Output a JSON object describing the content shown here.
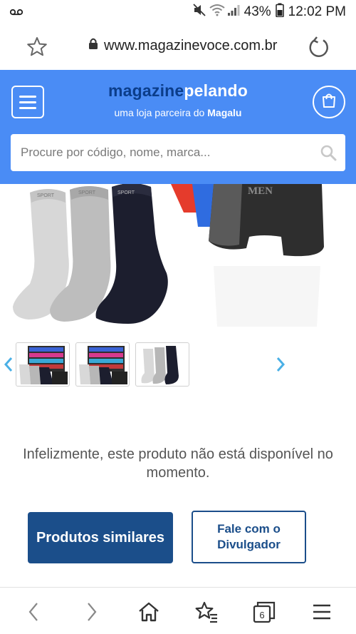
{
  "status_bar": {
    "left_icon": "voicemail-icon",
    "battery": "43%",
    "time": "12:02 PM"
  },
  "browser": {
    "url": "www.magazinevoce.com.br"
  },
  "header": {
    "brand_part1": "magazine",
    "brand_part2": "pelando",
    "tagline_prefix": "uma loja parceira do",
    "tagline_brand": "Magalu",
    "accent_color": "#4a8cf5"
  },
  "search": {
    "placeholder": "Procure por código, nome, marca..."
  },
  "product": {
    "image_alt": "Meias Sport e cuecas boxer",
    "thumbnails": [
      "thumbnail-1",
      "thumbnail-2",
      "thumbnail-3"
    ]
  },
  "message": {
    "unavailable_text": "Infelizmente, este produto não está disponível no momento."
  },
  "buttons": {
    "similar_label": "Produtos similares",
    "contact_label": "Fale com o Divulgador"
  },
  "bottom_nav": {
    "tabs_count": "6"
  }
}
